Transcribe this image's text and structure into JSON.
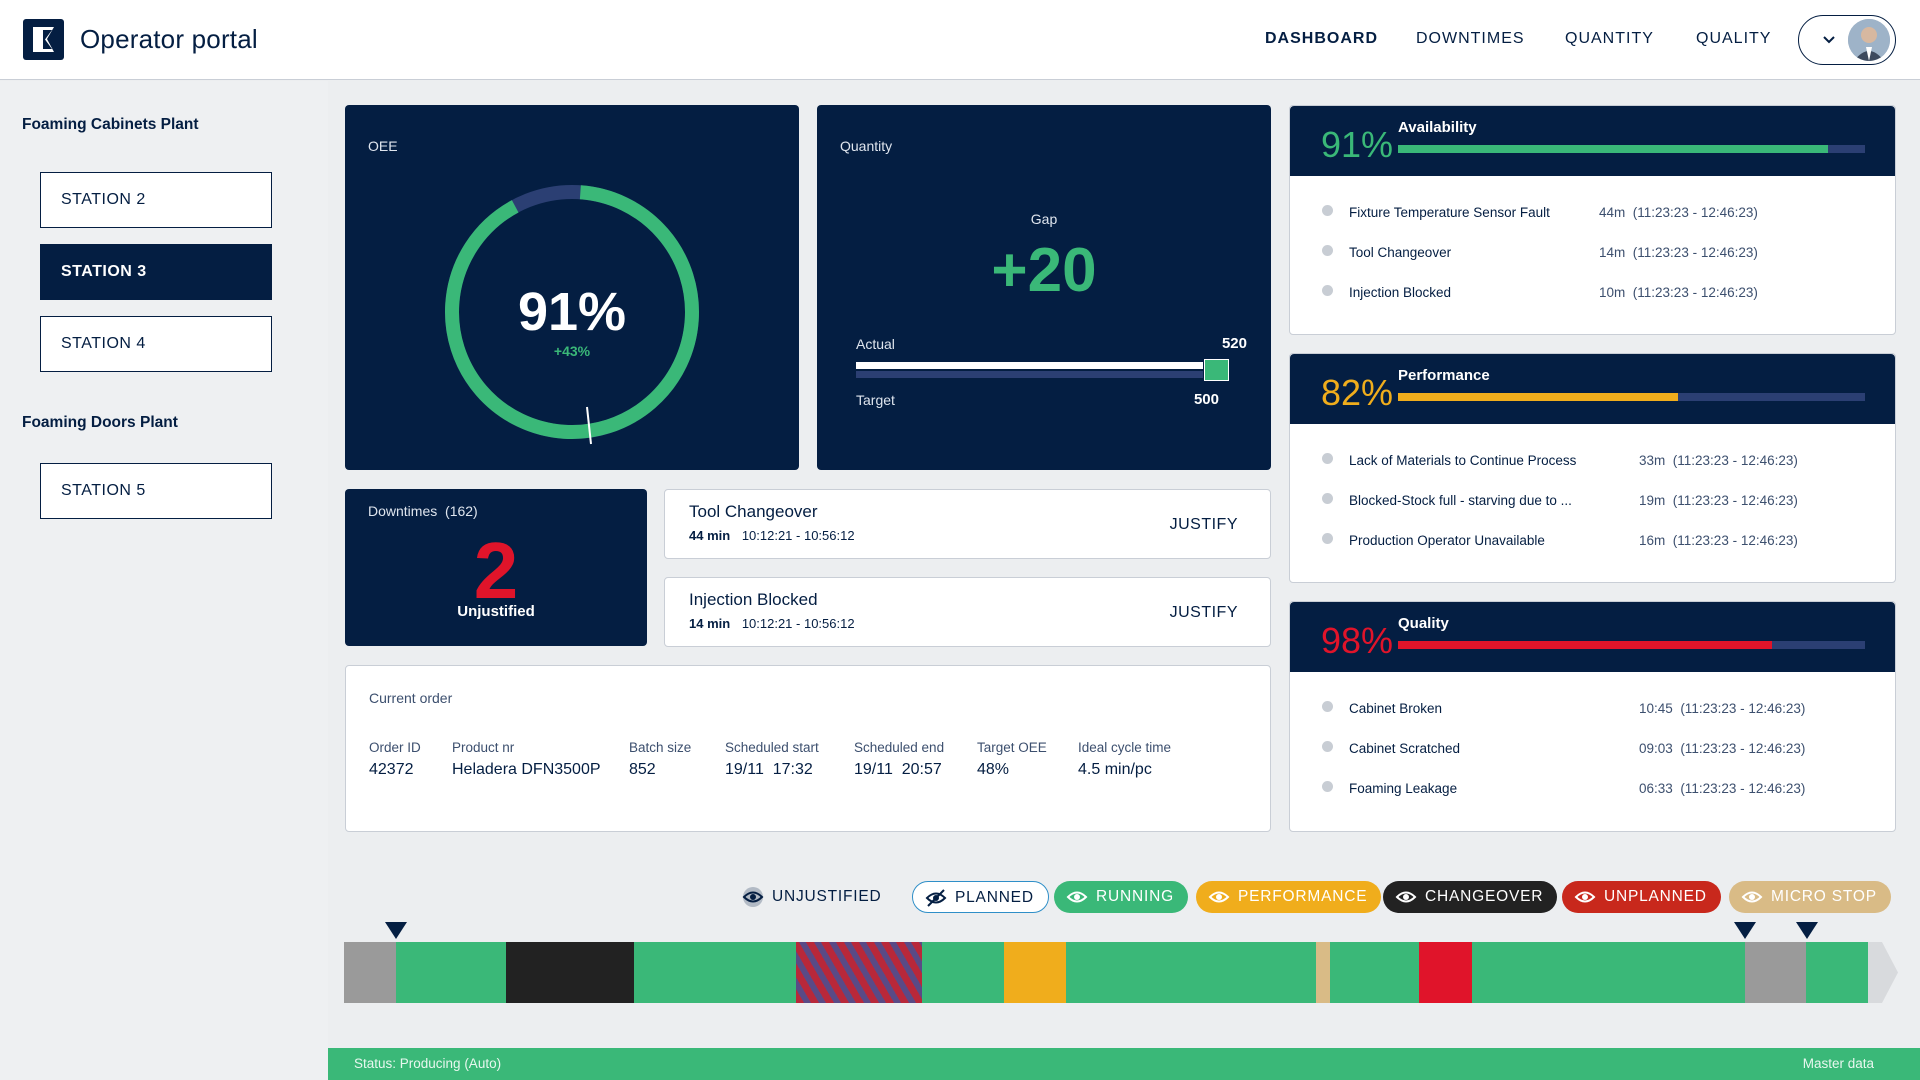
{
  "header": {
    "app_title": "Operator portal",
    "nav": [
      "DASHBOARD",
      "DOWNTIMES",
      "QUANTITY",
      "QUALITY"
    ],
    "active_nav": "DASHBOARD"
  },
  "sidebar": {
    "plants": [
      {
        "name": "Foaming Cabinets Plant",
        "stations": [
          "STATION 2",
          "STATION 3",
          "STATION 4"
        ]
      },
      {
        "name": "Foaming Doors Plant",
        "stations": [
          "STATION 5"
        ]
      }
    ],
    "active_station": "STATION 3"
  },
  "oee": {
    "label": "OEE",
    "value": "91%",
    "value_fraction": 0.91,
    "delta": "+43%"
  },
  "quantity": {
    "label": "Quantity",
    "gap_label": "Gap",
    "gap_value": "+20",
    "actual_label": "Actual",
    "actual_value": "520",
    "target_label": "Target",
    "target_value": "500"
  },
  "downtimes": {
    "label": "Downtimes",
    "count": "(162)",
    "unjustified_count": "2",
    "unjustified_label": "Unjustified"
  },
  "downtime_events": [
    {
      "title": "Tool Changeover",
      "duration": "44 min",
      "range": "10:12:21 - 10:56:12",
      "action": "JUSTIFY"
    },
    {
      "title": "Injection Blocked",
      "duration": "14 min",
      "range": "10:12:21 - 10:56:12",
      "action": "JUSTIFY"
    }
  ],
  "current_order": {
    "label": "Current order",
    "fields": [
      {
        "key": "Order ID",
        "value": "42372"
      },
      {
        "key": "Product nr",
        "value": "Heladera DFN3500P"
      },
      {
        "key": "Batch size",
        "value": "852"
      },
      {
        "key": "Scheduled start",
        "value": "19/11  17:32"
      },
      {
        "key": "Scheduled end",
        "value": "19/11  20:57"
      },
      {
        "key": "Target OEE",
        "value": "48%"
      },
      {
        "key": "Ideal cycle time",
        "value": "4.5 min/pc"
      }
    ]
  },
  "kpis": [
    {
      "name": "Availability",
      "value": "91%",
      "fraction": 0.92,
      "color": "#3ab878",
      "items": [
        {
          "label": "Fixture Temperature Sensor Fault",
          "dur": "44m",
          "range": "(11:23:23 - 12:46:23)"
        },
        {
          "label": "Tool Changeover",
          "dur": "14m",
          "range": "(11:23:23 - 12:46:23)"
        },
        {
          "label": "Injection Blocked",
          "dur": "10m",
          "range": "(11:23:23 - 12:46:23)"
        }
      ]
    },
    {
      "name": "Performance",
      "value": "82%",
      "fraction": 0.6,
      "color": "#f0ad1c",
      "items": [
        {
          "label": "Lack of Materials to Continue Process",
          "dur": "33m",
          "range": "(11:23:23 - 12:46:23)"
        },
        {
          "label": "Blocked-Stock full - starving due to ...",
          "dur": "19m",
          "range": "(11:23:23 - 12:46:23)"
        },
        {
          "label": "Production Operator Unavailable",
          "dur": "16m",
          "range": "(11:23:23 - 12:46:23)"
        }
      ]
    },
    {
      "name": "Quality",
      "value": "98%",
      "fraction": 0.8,
      "color": "#e0142a",
      "items": [
        {
          "label": "Cabinet Broken",
          "dur": "10:45",
          "range": "(11:23:23 - 12:46:23)"
        },
        {
          "label": "Cabinet Scratched",
          "dur": "09:03",
          "range": "(11:23:23 - 12:46:23)"
        },
        {
          "label": "Foaming Leakage",
          "dur": "06:33",
          "range": "(11:23:23 - 12:46:23)"
        }
      ]
    }
  ],
  "legend": [
    {
      "label": "UNJUSTIFIED",
      "icon": "eye-icon",
      "bg": "transparent",
      "fg": "#041e42",
      "border": "none"
    },
    {
      "label": "PLANNED",
      "icon": "eye-off-icon",
      "bg": "#ffffff",
      "fg": "#041e42",
      "border": "#2f8fc8"
    },
    {
      "label": "RUNNING",
      "icon": "eye-icon",
      "bg": "#3ab878",
      "fg": "#ffffff",
      "border": "none"
    },
    {
      "label": "PERFORMANCE",
      "icon": "eye-icon",
      "bg": "#f0ad1c",
      "fg": "#ffffff",
      "border": "none"
    },
    {
      "label": "CHANGEOVER",
      "icon": "eye-icon",
      "bg": "#222222",
      "fg": "#ffffff",
      "border": "none"
    },
    {
      "label": "UNPLANNED",
      "icon": "eye-icon",
      "bg": "#c8281c",
      "fg": "#ffffff",
      "border": "none"
    },
    {
      "label": "MICRO STOP",
      "icon": "eye-icon",
      "bg": "#d9bb86",
      "fg": "#ffffff",
      "border": "none"
    }
  ],
  "status": {
    "left": "Status: Producing (Auto)",
    "right": "Master data"
  },
  "colors": {
    "navy": "#041e42",
    "running": "#3ab878",
    "performance": "#f0ad1c",
    "changeover": "#222222",
    "unplanned": "#e0142a",
    "microstop": "#d9bb86",
    "idle": "#9a9a9a",
    "unjustified": "#b8283a"
  }
}
